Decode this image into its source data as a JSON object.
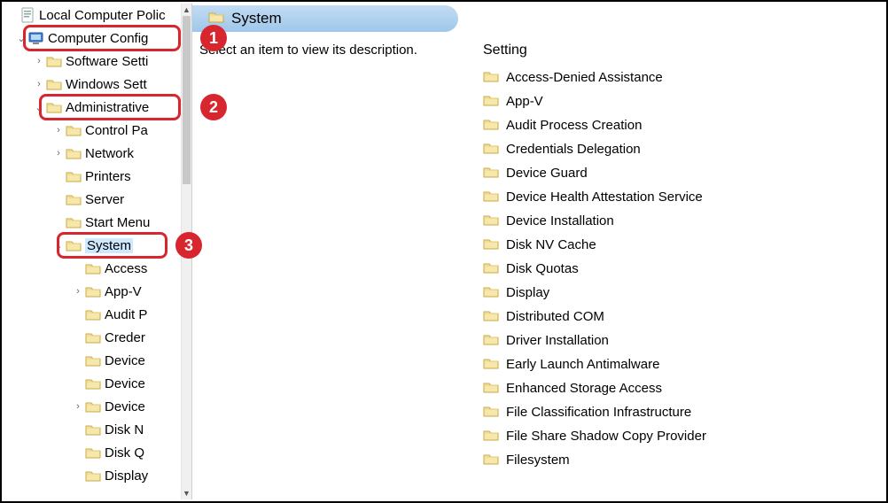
{
  "callouts": {
    "n1": "1",
    "n2": "2",
    "n3": "3"
  },
  "tree": {
    "root_label": "Local Computer Polic",
    "nodes": {
      "computer_config": "Computer Config",
      "software_settings": "Software Setti",
      "windows_settings": "Windows Sett",
      "admin_templates": "Administrative",
      "control_panel": "Control Pa",
      "network": "Network",
      "printers": "Printers",
      "server": "Server",
      "start_menu": "Start Menu",
      "system": "System",
      "access": "Access",
      "app_v": "App-V",
      "audit": "Audit P",
      "creden": "Creder",
      "device1": "Device",
      "device2": "Device",
      "device3": "Device",
      "disk_n": "Disk N",
      "disk_q": "Disk Q",
      "display": "Display"
    }
  },
  "right": {
    "title": "System",
    "description_hint": "Select an item to view its description.",
    "column_header": "Setting",
    "settings": [
      "Access-Denied Assistance",
      "App-V",
      "Audit Process Creation",
      "Credentials Delegation",
      "Device Guard",
      "Device Health Attestation Service",
      "Device Installation",
      "Disk NV Cache",
      "Disk Quotas",
      "Display",
      "Distributed COM",
      "Driver Installation",
      "Early Launch Antimalware",
      "Enhanced Storage Access",
      "File Classification Infrastructure",
      "File Share Shadow Copy Provider",
      "Filesystem"
    ]
  }
}
